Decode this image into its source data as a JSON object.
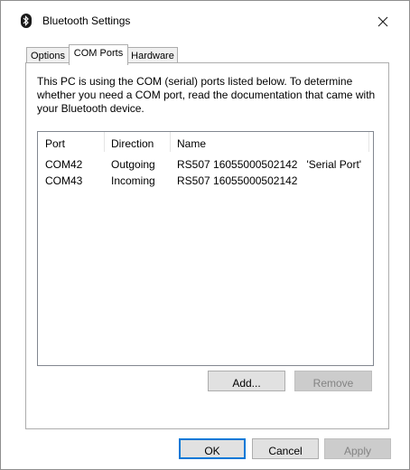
{
  "window": {
    "title": "Bluetooth Settings"
  },
  "tabs": [
    {
      "label": "Options"
    },
    {
      "label": "COM Ports"
    },
    {
      "label": "Hardware"
    }
  ],
  "description": "This PC is using the COM (serial) ports listed below. To determine whether you need a COM port, read the documentation that came with your Bluetooth device.",
  "table": {
    "columns": [
      "Port",
      "Direction",
      "Name"
    ],
    "rows": [
      [
        "COM42",
        "Outgoing",
        "RS507 16055000502142   'Serial Port'"
      ],
      [
        "COM43",
        "Incoming",
        "RS507 16055000502142"
      ]
    ]
  },
  "buttons": {
    "add": "Add...",
    "remove": "Remove",
    "ok": "OK",
    "cancel": "Cancel",
    "apply": "Apply"
  },
  "icons": {
    "app": "bluetooth-icon",
    "close": "close-icon"
  }
}
